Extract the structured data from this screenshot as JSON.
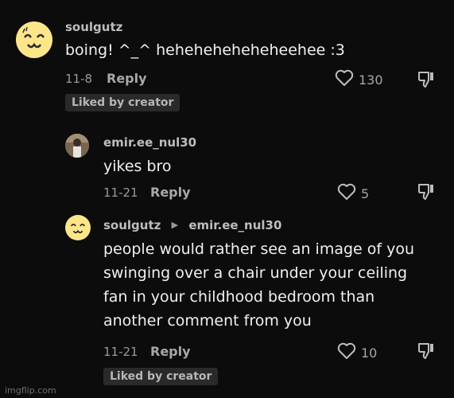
{
  "comments": [
    {
      "username": "soulgutz",
      "text": "boing! ^_^ heheheheheheheehee :3",
      "date": "11-8",
      "reply_label": "Reply",
      "like_count": "130",
      "badge": "Liked by creator"
    },
    {
      "username": "emir.ee_nul30",
      "text": "yikes bro",
      "date": "11-21",
      "reply_label": "Reply",
      "like_count": "5"
    },
    {
      "username": "soulgutz",
      "reply_to": "emir.ee_nul30",
      "text_lines": [
        "people would rather see an image of you",
        "swinging over a chair under your ceiling",
        "fan in your childhood bedroom than",
        "another comment from you"
      ],
      "date": "11-21",
      "reply_label": "Reply",
      "like_count": "10",
      "badge": "Liked by creator"
    }
  ],
  "watermark": "imgflip.com",
  "icons": {
    "like": "heart-outline-icon",
    "dislike": "thumbs-down-icon",
    "reply_arrow": "triangle-right-icon"
  },
  "colors": {
    "background": "#0c0c0c",
    "emoji_avatar": "#fde68a"
  }
}
